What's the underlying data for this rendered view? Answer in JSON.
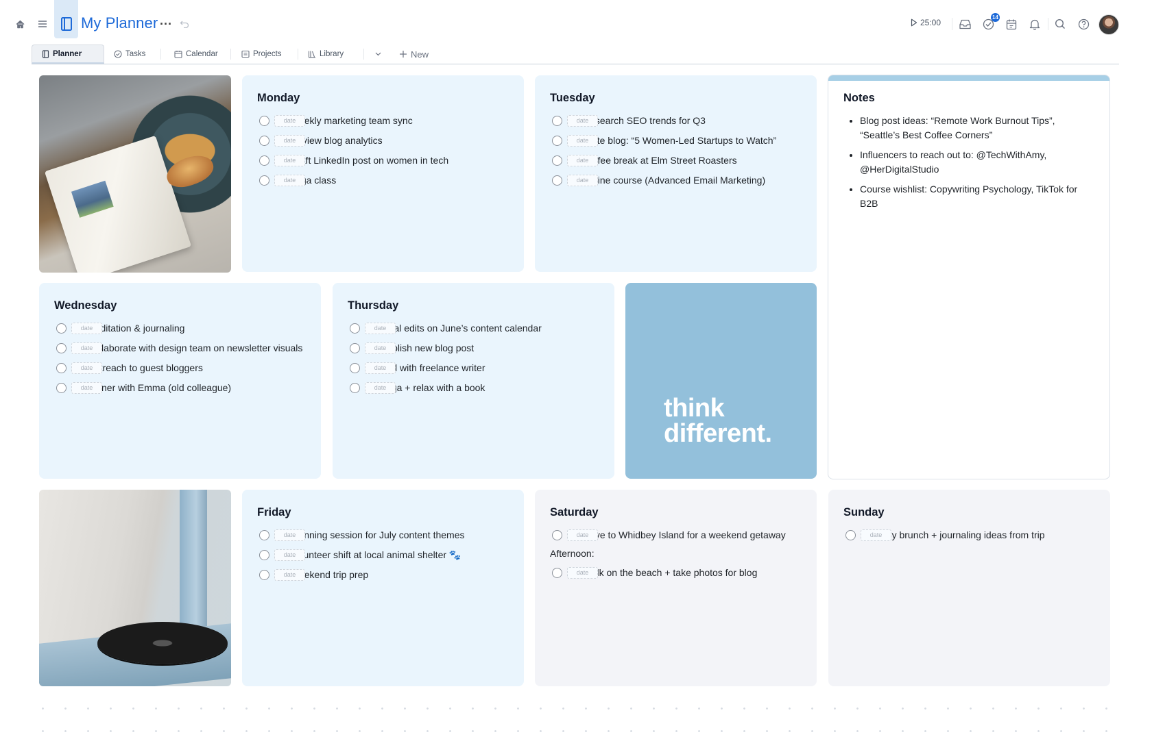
{
  "header": {
    "title": "My Planner",
    "timer": "25:00",
    "tasks_badge": "14"
  },
  "tabs": [
    {
      "label": "Planner",
      "icon": "planner-icon",
      "active": true
    },
    {
      "label": "Tasks",
      "icon": "check-circle-icon"
    },
    {
      "label": "Calendar",
      "icon": "calendar-icon"
    },
    {
      "label": "Projects",
      "icon": "projects-icon"
    },
    {
      "label": "Library",
      "icon": "library-icon"
    }
  ],
  "new_label": "New",
  "date_placeholder": "date",
  "days": {
    "monday": {
      "title": "Monday",
      "tasks": [
        "Weekly marketing team sync",
        "Review blog analytics",
        "Draft LinkedIn post on women in tech",
        "Yoga class"
      ]
    },
    "tuesday": {
      "title": "Tuesday",
      "tasks": [
        "Research SEO trends for Q3",
        "Write blog: “5 Women-Led Startups to Watch”",
        "Coffee break at Elm Street Roasters",
        "Online course (Advanced Email Marketing)"
      ]
    },
    "wednesday": {
      "title": "Wednesday",
      "tasks": [
        "Meditation & journaling",
        "Collaborate with design team on newsletter visuals",
        "Outreach to guest bloggers",
        "Dinner with Emma (old colleague)"
      ]
    },
    "thursday": {
      "title": "Thursday",
      "tasks": [
        "Final edits on June’s content calendar",
        "Publish new blog post",
        "Call with freelance writer",
        "Yoga + relax with a book"
      ]
    },
    "friday": {
      "title": "Friday",
      "tasks": [
        "Planning session for July content themes",
        "Volunteer shift at local animal shelter 🐾",
        "Weekend trip prep"
      ]
    },
    "saturday": {
      "title": "Saturday",
      "tasks": [
        "Drive to Whidbey Island for a weekend getaway"
      ],
      "afternoon_label": "Afternoon:",
      "afternoon_tasks": [
        "Walk on the beach + take photos for blog"
      ]
    },
    "sunday": {
      "title": "Sunday",
      "tasks": [
        "Lazy brunch + journaling ideas from trip"
      ]
    }
  },
  "notes": {
    "title": "Notes",
    "items": [
      "Blog post ideas: “Remote Work Burnout Tips”, “Seattle’s Best Coffee Corners”",
      "Influencers to reach out to: @TechWithAmy, @HerDigitalStudio",
      "Course wishlist: Copywriting Psychology, TikTok for B2B"
    ]
  },
  "quote": {
    "line1": "think",
    "line2": "different."
  },
  "colors": {
    "accent": "#1e6ad8",
    "card_blue": "#eaf5fd",
    "card_gray": "#f3f4f8",
    "quote_bg": "#93c0db"
  }
}
